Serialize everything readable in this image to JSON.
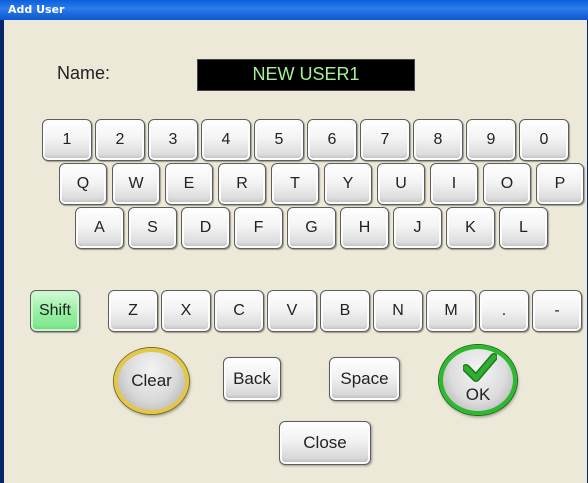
{
  "window": {
    "title": "Add User"
  },
  "name_field": {
    "label": "Name:",
    "value": "NEW USER1"
  },
  "keyboard": {
    "row1": [
      "1",
      "2",
      "3",
      "4",
      "5",
      "6",
      "7",
      "8",
      "9",
      "0"
    ],
    "row2": [
      "Q",
      "W",
      "E",
      "R",
      "T",
      "Y",
      "U",
      "I",
      "O",
      "P"
    ],
    "row3": [
      "A",
      "S",
      "D",
      "F",
      "G",
      "H",
      "J",
      "K",
      "L"
    ],
    "row4": [
      "Shift",
      "Z",
      "X",
      "C",
      "V",
      "B",
      "N",
      "M",
      ".",
      "-"
    ]
  },
  "controls": {
    "clear": "Clear",
    "back": "Back",
    "space": "Space",
    "ok": "OK",
    "close": "Close"
  },
  "colors": {
    "display_text": "#A6F096",
    "shift_key": "#8BEA98",
    "clear_ring": "#E2C84A",
    "ok_ring": "#2DB82D",
    "checkmark": "#2FAF2F"
  },
  "icons": {
    "ok": "checkmark-icon"
  }
}
